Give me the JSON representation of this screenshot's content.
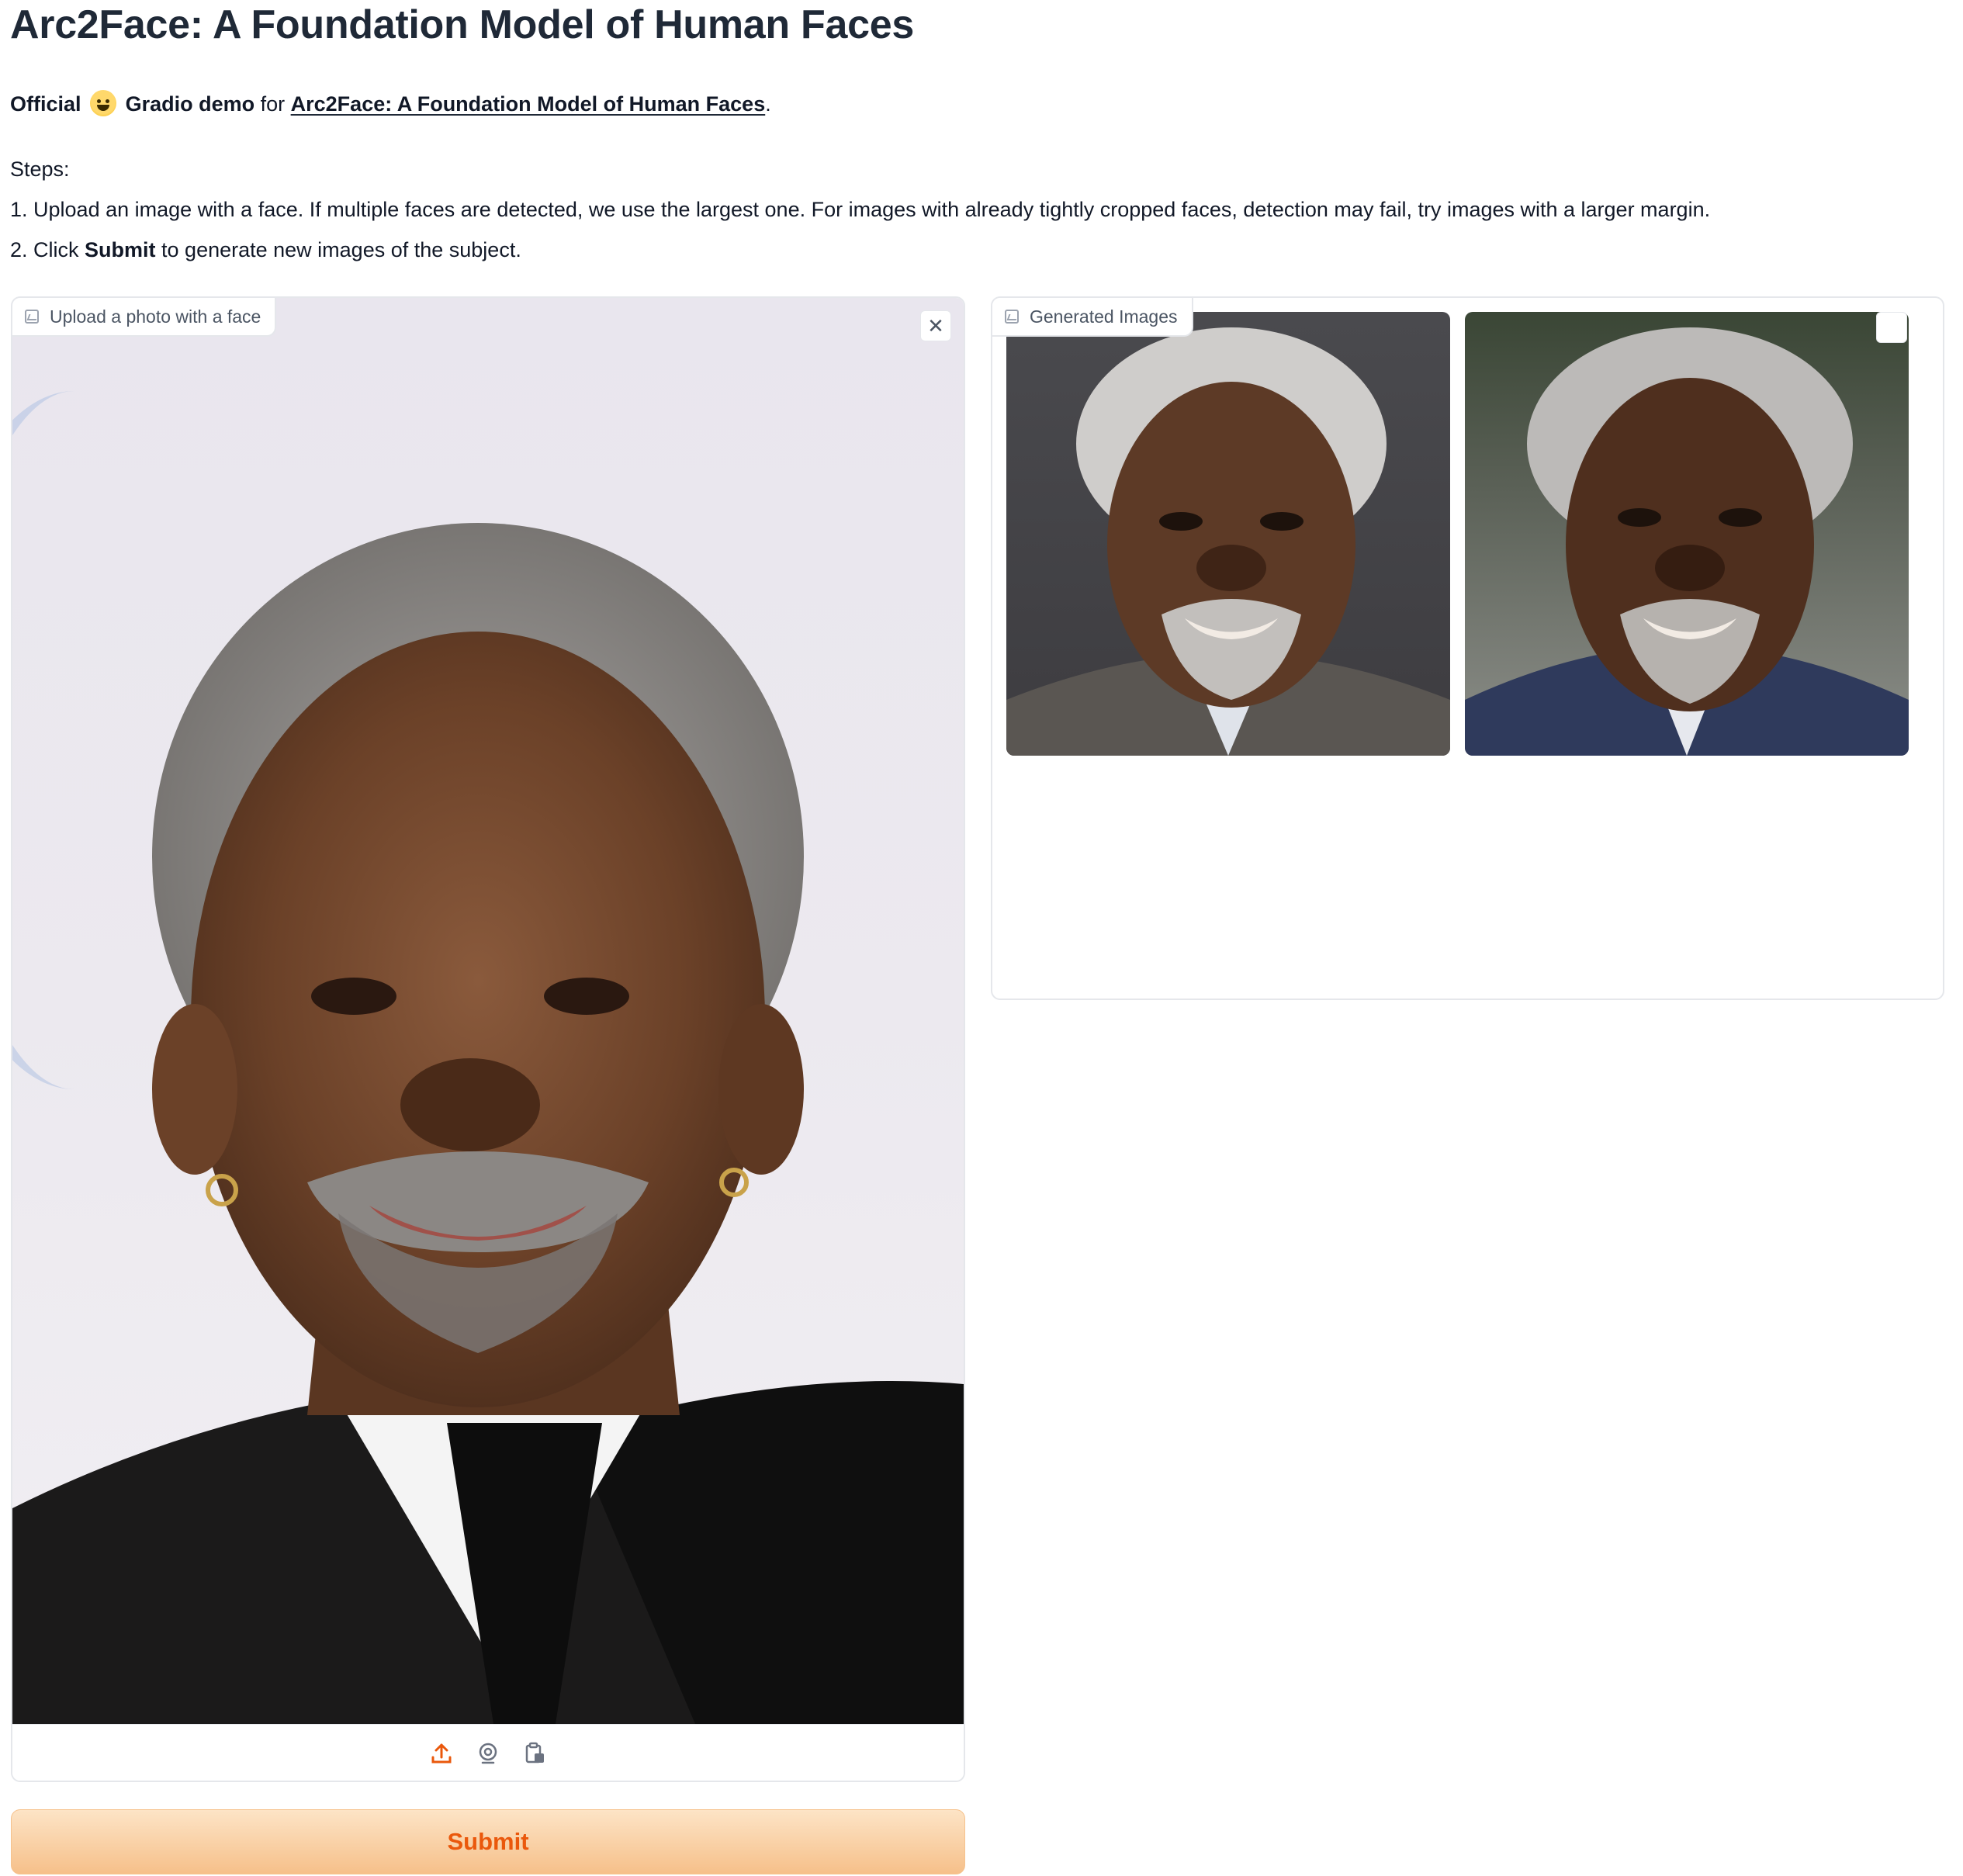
{
  "header": {
    "title": "Arc2Face: A Foundation Model of Human Faces"
  },
  "intro": {
    "official": "Official",
    "gradio_demo": "Gradio demo",
    "for": "for",
    "link_text": "Arc2Face: A Foundation Model of Human Faces",
    "period": "."
  },
  "steps": {
    "heading": "Steps:",
    "step1": "1. Upload an image with a face. If multiple faces are detected, we use the largest one. For images with already tightly cropped faces, detection may fail, try images with a larger margin.",
    "step2_prefix": "2. Click ",
    "step2_bold": "Submit",
    "step2_suffix": " to generate new images of the subject."
  },
  "input_panel": {
    "label": "Upload a photo with a face",
    "close_icon": "close-icon",
    "sources": [
      "upload-icon",
      "webcam-icon",
      "clipboard-icon"
    ]
  },
  "output_panel": {
    "label": "Generated Images",
    "images": [
      "generated-image-1",
      "generated-image-2"
    ]
  },
  "actions": {
    "submit_label": "Submit"
  },
  "colors": {
    "accent": "#ea580c",
    "submit_bg_top": "#fde4c6",
    "submit_bg_bottom": "#f6c08a",
    "border": "#e5e7eb",
    "text": "#1f2937"
  }
}
